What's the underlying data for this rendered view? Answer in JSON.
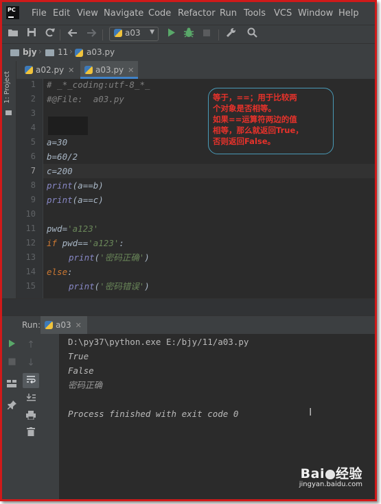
{
  "menu": {
    "logo": "PC",
    "items": [
      "File",
      "Edit",
      "View",
      "Navigate",
      "Code",
      "Refactor",
      "Run",
      "Tools",
      "VCS",
      "Window",
      "Help"
    ]
  },
  "toolbar": {
    "run_config": "a03",
    "icons": [
      "folder-open-icon",
      "save-icon",
      "sync-icon",
      "back-arrow-icon",
      "forward-arrow-icon",
      "run-icon",
      "debug-icon",
      "stop-icon",
      "wrench-icon",
      "search-icon"
    ]
  },
  "breadcrumb": {
    "items": [
      "bjy",
      "11",
      "a03.py"
    ]
  },
  "leftstrip": {
    "project_label": "1: Project"
  },
  "tabs": [
    {
      "label": "a02.py",
      "active": false
    },
    {
      "label": "a03.py",
      "active": true
    }
  ],
  "editor": {
    "line_numbers": [
      "1",
      "2",
      "3",
      "4",
      "5",
      "6",
      "7",
      "8",
      "9",
      "10",
      "11",
      "12",
      "13",
      "14",
      "15"
    ],
    "current_line": 7,
    "lines": {
      "l1": "# _*_coding:utf-8_*_",
      "l2": "#@File:  a03.py",
      "l5": "a=30",
      "l6": "b=60/2",
      "l7": "c=200",
      "l8_fn": "print",
      "l8_rest": "(a==b)",
      "l9_fn": "print",
      "l9_rest": "(a==c)",
      "l11_var": "pwd=",
      "l11_str": "'a123'",
      "l12_kw": "if",
      "l12_var": " pwd==",
      "l12_str": "'a123'",
      "l12_end": ":",
      "l13_fn": "print",
      "l13_open": "(",
      "l13_str": "'密码正确'",
      "l13_close": ")",
      "l14_kw": "else",
      "l14_end": ":",
      "l15_fn": "print",
      "l15_open": "(",
      "l15_str": "'密码错误'",
      "l15_close": ")"
    }
  },
  "annotation": {
    "line1": "等于，==；用于比较两",
    "line2": "个对象是否相等。",
    "line3": "如果==运算符两边的值",
    "line4": "相等，那么就返回True，",
    "line5": "否则返回False。"
  },
  "run_panel": {
    "label": "Run:",
    "tab": "a03",
    "console": [
      "D:\\py37\\python.exe E:/bjy/11/a03.py",
      "True",
      "False",
      "密码正确",
      "",
      "Process finished with exit code 0"
    ]
  },
  "watermark": {
    "logo": "Bai",
    "logo_cn": "经验",
    "url": "jingyan.baidu.com"
  },
  "colors": {
    "frame_border": "#d01a1a",
    "editor_bg": "#2b2b2b",
    "chrome_bg": "#3c3f41",
    "annotation_text": "#e8322b",
    "annotation_border": "#4a9bb8",
    "keyword": "#cc7832",
    "string": "#6a8759",
    "comment": "#808080"
  }
}
